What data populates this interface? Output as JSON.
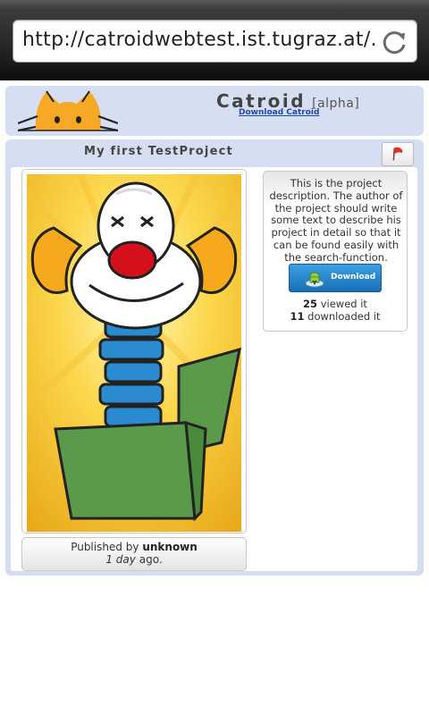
{
  "browser": {
    "url": "http://catroidwebtest.ist.tugraz.at/...",
    "reload_icon": "reload-icon"
  },
  "header": {
    "app_name": "Catroid",
    "alpha_tag": "[alpha]",
    "download_link": "Download Catroid",
    "logo_icon": "catroid-cat-logo"
  },
  "project": {
    "title": "My first TestProject",
    "flag_icon": "report-flag-icon",
    "description": "This is the project description. The author of the project should write some text to describe his project in detail so that it can be found easily with the search-function.",
    "download_button": "Download",
    "views_count": "25",
    "views_label": "viewed it",
    "downloads_count": "11",
    "downloads_label": "downloaded it",
    "published_by_label": "Published by",
    "author": "unknown",
    "age": "1 day",
    "age_suffix": "ago.",
    "thumbnail": "clown-jack-in-the-box-image"
  }
}
